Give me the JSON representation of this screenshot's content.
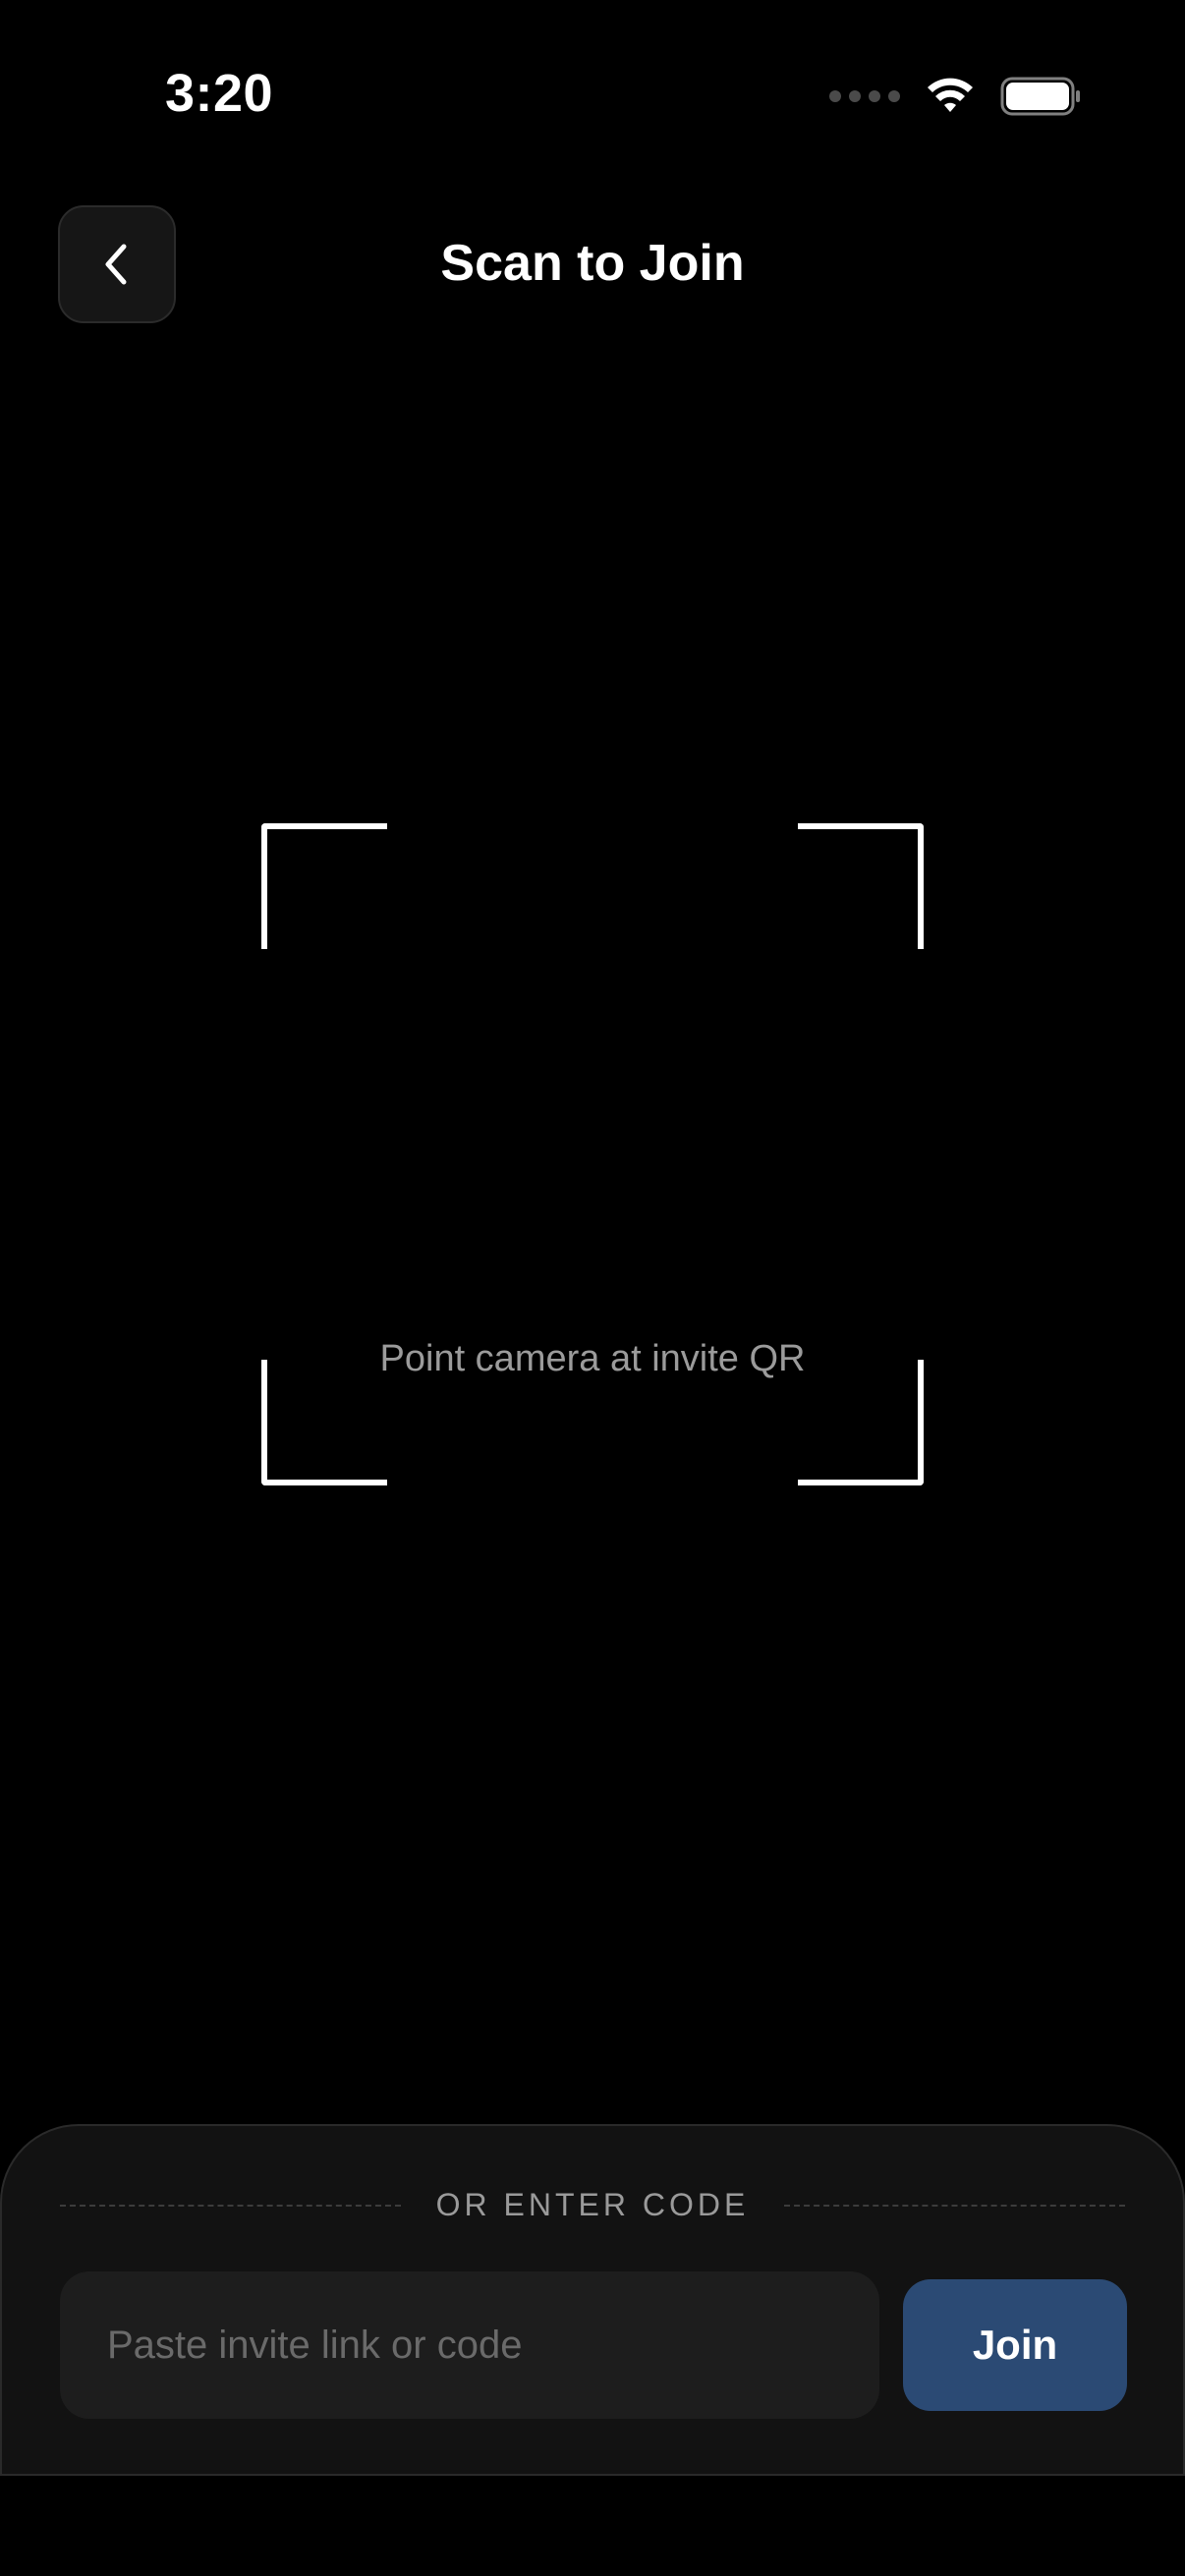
{
  "status_bar": {
    "time": "3:20",
    "wifi_icon": "wifi-icon",
    "battery_icon": "battery-icon",
    "signal_icon": "signal-dots-icon"
  },
  "header": {
    "back_icon": "chevron-left-icon",
    "title": "Scan to Join"
  },
  "scanner": {
    "hint": "Point camera at invite QR",
    "frame_color": "#ffffff"
  },
  "manual_entry": {
    "divider_label": "OR ENTER CODE",
    "input_placeholder": "Paste invite link or code",
    "input_value": "",
    "join_label": "Join"
  },
  "colors": {
    "background": "#000000",
    "sheet": "#121212",
    "input": "#1d1d1d",
    "join_button": "#2b4a74",
    "muted_text": "#9b9b9b"
  }
}
